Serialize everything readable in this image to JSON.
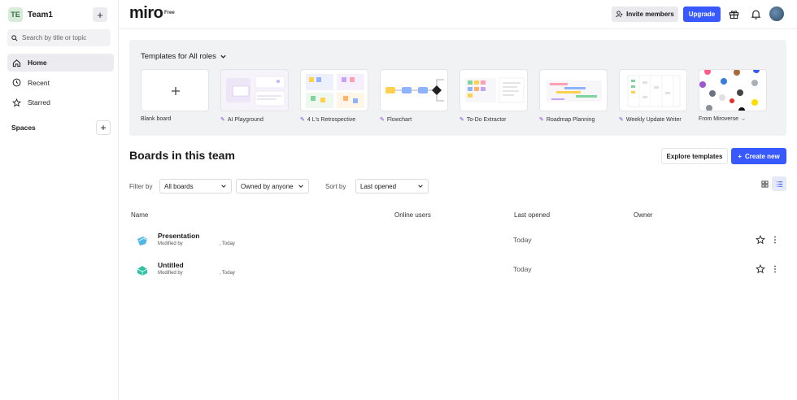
{
  "sidebar": {
    "team_initials": "TE",
    "team_name": "Team1",
    "search_placeholder": "Search by title or topic",
    "nav": [
      {
        "label": "Home",
        "icon": "home-icon"
      },
      {
        "label": "Recent",
        "icon": "clock-icon"
      },
      {
        "label": "Starred",
        "icon": "star-icon"
      }
    ],
    "spaces_label": "Spaces"
  },
  "topbar": {
    "logo": "miro",
    "plan": "Free",
    "invite_label": "Invite members",
    "upgrade_label": "Upgrade"
  },
  "templates": {
    "heading": "Templates for All roles",
    "items": [
      {
        "label": "Blank board",
        "ai": false
      },
      {
        "label": "AI Playground",
        "ai": true
      },
      {
        "label": "4 L's Retrospective",
        "ai": true
      },
      {
        "label": "Flowchart",
        "ai": true
      },
      {
        "label": "To-Do Extractor",
        "ai": true
      },
      {
        "label": "Roadmap Planning",
        "ai": true
      },
      {
        "label": "Weekly Update Writer",
        "ai": true
      },
      {
        "label": "From Miroverse →",
        "ai": false
      }
    ]
  },
  "main": {
    "title": "Boards in this team",
    "explore_label": "Explore templates",
    "create_label": "Create new",
    "filter_label": "Filter by",
    "filter_value": "All boards",
    "owner_value": "Owned by anyone",
    "sort_label": "Sort by",
    "sort_value": "Last opened"
  },
  "table": {
    "columns": [
      "Name",
      "Online users",
      "Last opened",
      "Owner"
    ],
    "rows": [
      {
        "title": "Presentation",
        "modified": "Modified by",
        "when": ", Today",
        "last_opened": "Today"
      },
      {
        "title": "Untitled",
        "modified": "Modified by",
        "when": ", Today",
        "last_opened": "Today"
      }
    ]
  },
  "colors": {
    "accent": "#3859ff",
    "panel": "#f1f2f4"
  }
}
